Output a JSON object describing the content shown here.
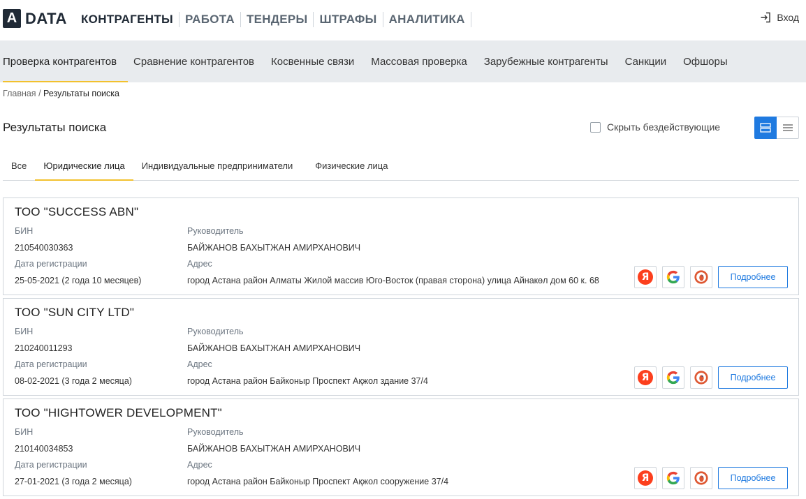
{
  "logo": {
    "letter": "A",
    "text": "DATA"
  },
  "nav": {
    "items": [
      "КОНТРАГЕНТЫ",
      "РАБОТА",
      "ТЕНДЕРЫ",
      "ШТРАФЫ",
      "АНАЛИТИКА"
    ],
    "active": "КОНТРАГЕНТЫ"
  },
  "login_label": "Вход",
  "subnav": {
    "items": [
      "Проверка контрагентов",
      "Сравнение контрагентов",
      "Косвенные связи",
      "Массовая проверка",
      "Зарубежные контрагенты",
      "Санкции",
      "Офшоры"
    ],
    "active": "Проверка контрагентов"
  },
  "breadcrumb": {
    "home": "Главная",
    "separator": "/",
    "current": "Результаты поиска"
  },
  "page_title": "Результаты поиска",
  "hide_inactive_label": "Скрыть бездействующие",
  "hide_inactive_checked": false,
  "view_mode": "cards",
  "tabs": {
    "items": [
      "Все",
      "Юридические лица",
      "Индивидуальные предприниматели",
      "Физические лица"
    ],
    "active": "Юридические лица"
  },
  "labels": {
    "bin": "БИН",
    "head": "Руководитель",
    "reg_date": "Дата регистрации",
    "address": "Адрес",
    "details": "Подробнее"
  },
  "results": [
    {
      "name": "ТОО \"SUCCESS ABN\"",
      "bin": "210540030363",
      "head": "БАЙЖАНОВ БАХЫТЖАН АМИРХАНОВИЧ",
      "reg_date": "25-05-2021 (2 года 10 месяцев)",
      "address": "город Астана район Алматы Жилой массив Юго-Восток (правая сторона) улица Айнакөл дом 60 к. 68"
    },
    {
      "name": "ТОО \"SUN CITY LTD\"",
      "bin": "210240011293",
      "head": "БАЙЖАНОВ БАХЫТЖАН АМИРХАНОВИЧ",
      "reg_date": "08-02-2021 (3 года 2 месяца)",
      "address": "город Астана район Байконыр Проспект Ақжол здание 37/4"
    },
    {
      "name": "ТОО \"HIGHTOWER DEVELOPMENT\"",
      "bin": "210140034853",
      "head": "БАЙЖАНОВ БАХЫТЖАН АМИРХАНОВИЧ",
      "reg_date": "27-01-2021 (3 года 2 месяца)",
      "address": "город Астана район Байконыр Проспект Ақжол сооружение 37/4"
    }
  ],
  "search_engines": [
    "yandex-icon",
    "google-icon",
    "duckduckgo-icon"
  ],
  "colors": {
    "accent": "#1f7ae0",
    "active_underline": "#f2c12e",
    "subnav_bg": "#e8ebee",
    "logo_bg": "#202a36",
    "yandex": "#fc3f1d",
    "duckduckgo": "#de5833"
  }
}
